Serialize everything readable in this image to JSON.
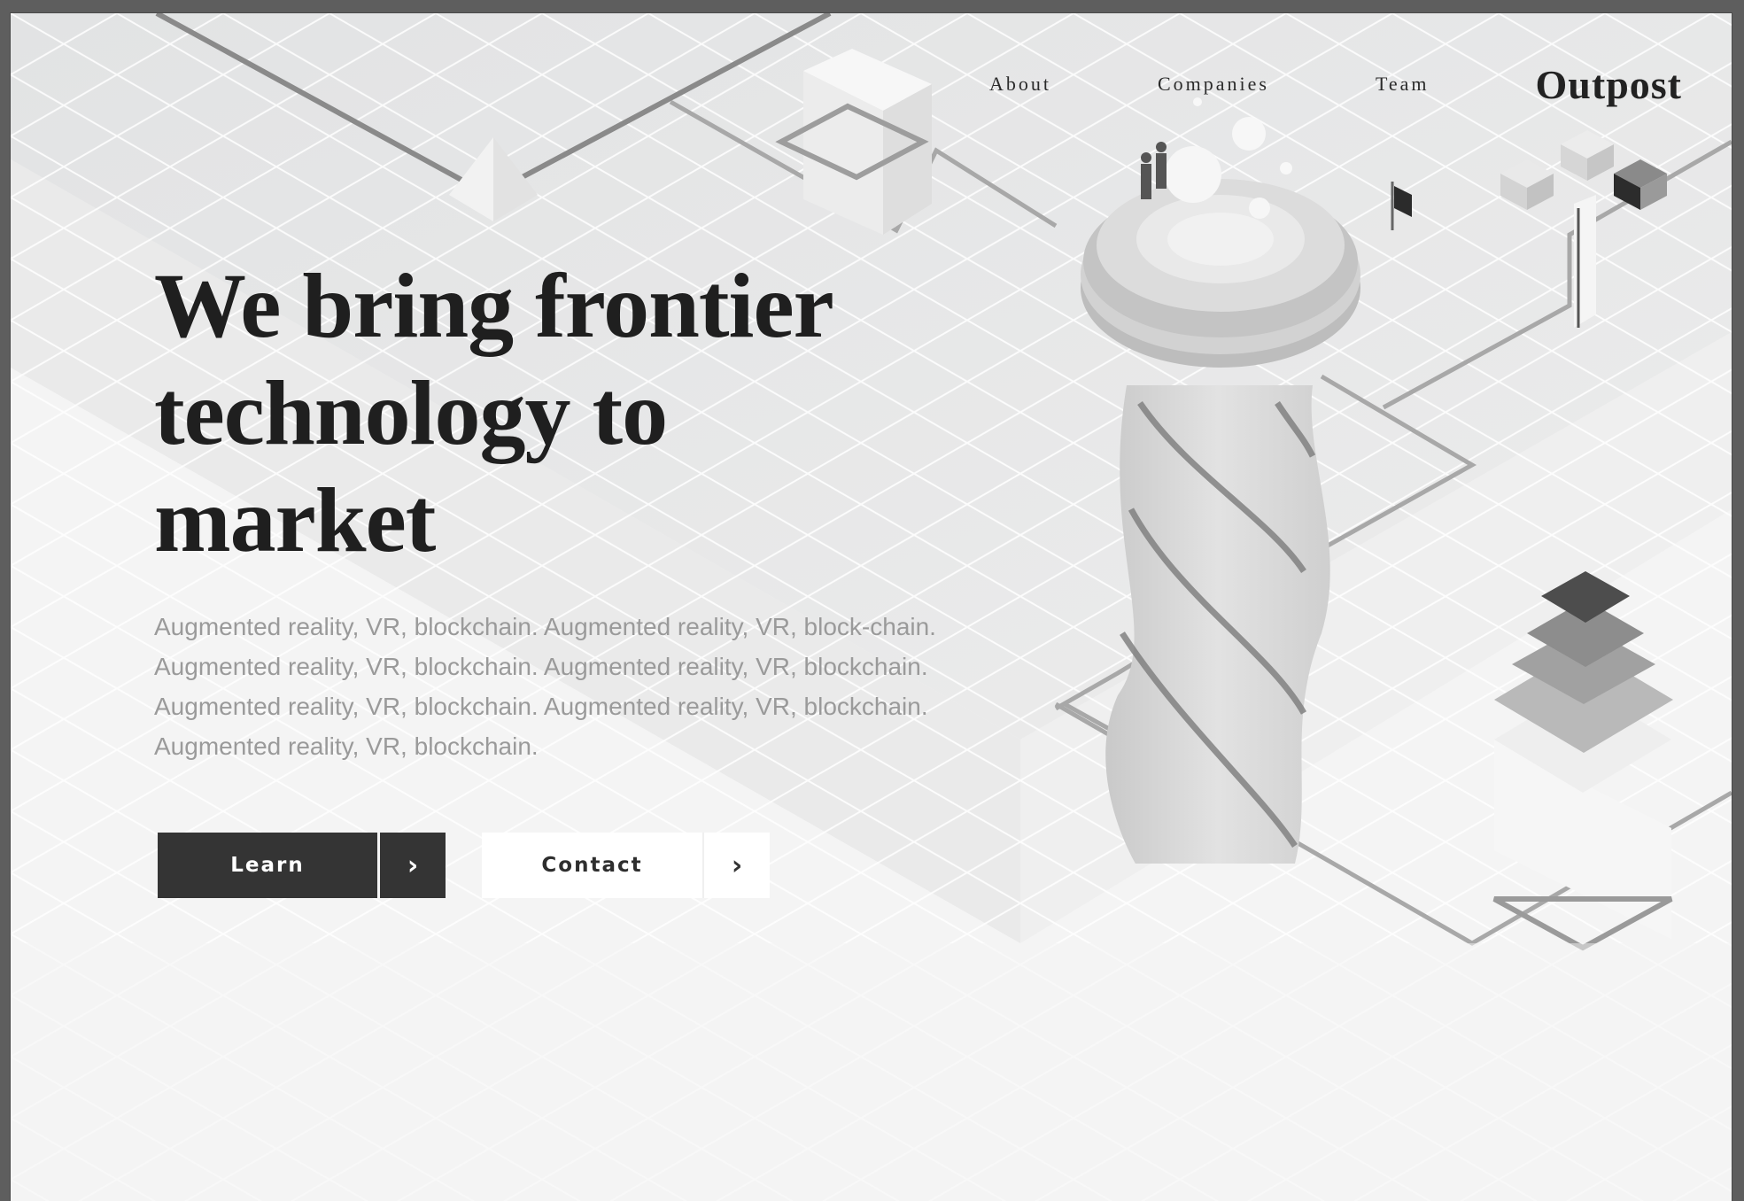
{
  "nav": {
    "links": [
      "About",
      "Companies",
      "Team"
    ],
    "brand": "Outpost"
  },
  "hero": {
    "title": "We bring frontier technology to market",
    "subtitle": "Augmented reality, VR, blockchain. Augmented reality, VR, block-chain. Augmented reality, VR, blockchain. Augmented reality, VR, blockchain. Augmented reality, VR, blockchain. Augmented reality, VR, blockchain. Augmented reality, VR, blockchain."
  },
  "buttons": {
    "learn_label": "Learn",
    "contact_label": "Contact",
    "arrow_icon": "chevron-right-icon"
  },
  "colors": {
    "background": "#f4f4f4",
    "text_dark": "#1f1f1f",
    "text_muted": "#9a9a9a",
    "button_dark": "#343434",
    "button_light": "#ffffff"
  }
}
